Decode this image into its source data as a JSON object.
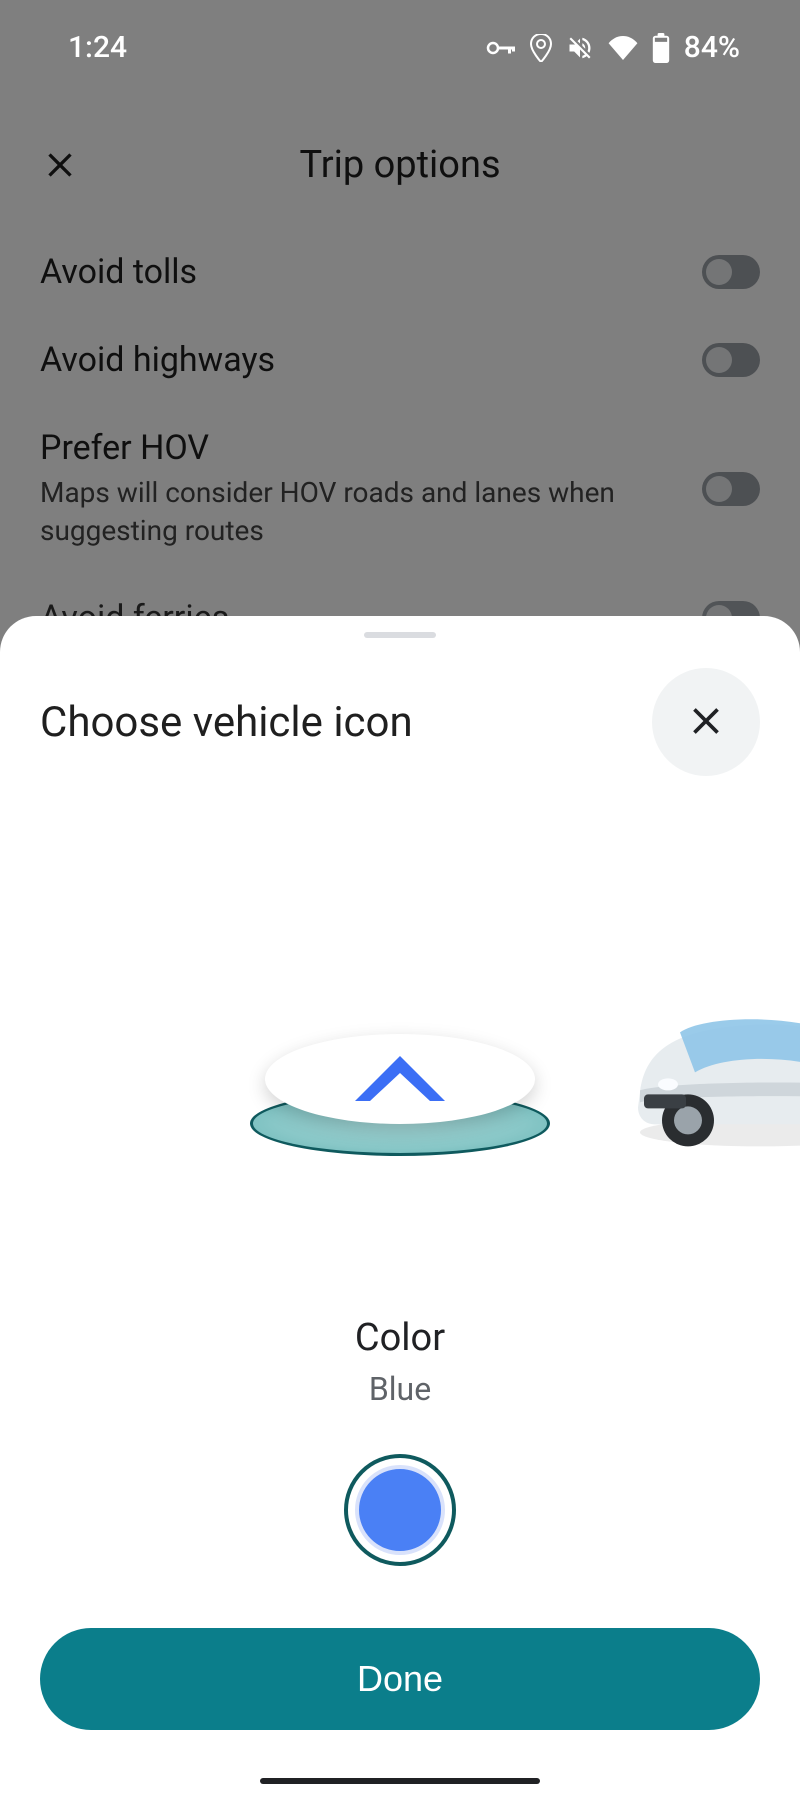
{
  "status": {
    "time": "1:24",
    "battery": "84%"
  },
  "trip": {
    "title": "Trip options",
    "options": [
      {
        "label": "Avoid tolls",
        "sub": ""
      },
      {
        "label": "Avoid highways",
        "sub": ""
      },
      {
        "label": "Prefer HOV",
        "sub": "Maps will consider HOV roads and lanes when suggesting routes"
      },
      {
        "label": "Avoid ferries",
        "sub": ""
      }
    ]
  },
  "sheet": {
    "title": "Choose vehicle icon",
    "color_label": "Color",
    "color_name": "Blue",
    "color_hex": "#4a80f5",
    "done": "Done"
  }
}
